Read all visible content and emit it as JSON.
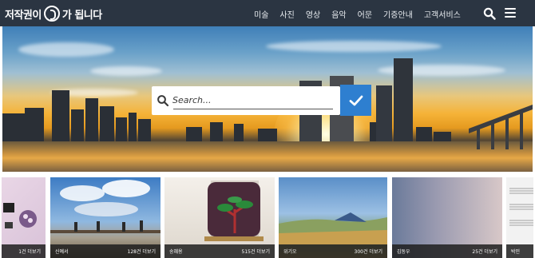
{
  "header": {
    "logo_text_left": "저작권이",
    "logo_text_right": "가 됩니다",
    "nav": [
      "미술",
      "사진",
      "영상",
      "음악",
      "어문",
      "기증안내",
      "고객서비스"
    ]
  },
  "search": {
    "placeholder": "Search..."
  },
  "cards": [
    {
      "name": "",
      "count": "1건 더보기"
    },
    {
      "name": "신예서",
      "count": "128건 더보기"
    },
    {
      "name": "송혜용",
      "count": "515건 더보기"
    },
    {
      "name": "위기오",
      "count": "300건 더보기"
    },
    {
      "name": "김동우",
      "count": "25건 더보기"
    },
    {
      "name": "박민",
      "count": ""
    }
  ],
  "colors": {
    "header_bg": "#2b3542",
    "search_button": "#2e7fd0"
  }
}
